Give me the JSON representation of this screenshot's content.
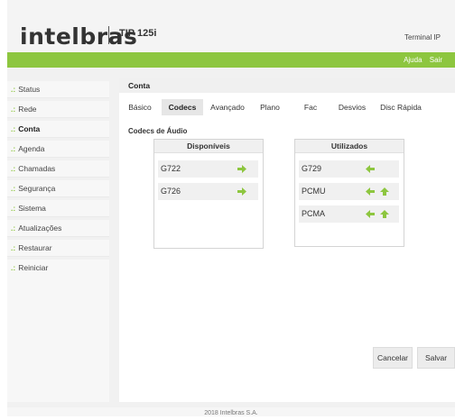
{
  "header": {
    "logo_text": "intelbras",
    "model": "TIP 125i",
    "device_label": "Terminal IP"
  },
  "topbar": {
    "help_label": "Ajuda",
    "logout_label": "Sair",
    "accent_color": "#8dc63f"
  },
  "sidebar": {
    "items": [
      {
        "label": "Status"
      },
      {
        "label": "Rede"
      },
      {
        "label": "Conta"
      },
      {
        "label": "Agenda"
      },
      {
        "label": "Chamadas"
      },
      {
        "label": "Segurança"
      },
      {
        "label": "Sistema"
      },
      {
        "label": "Atualizações"
      },
      {
        "label": "Restaurar"
      },
      {
        "label": "Reiniciar"
      }
    ],
    "bullet": ".:",
    "active_item": "Conta"
  },
  "main": {
    "title": "Conta",
    "tabs": [
      "Básico",
      "Codecs",
      "Avançado",
      "Plano",
      "Fac",
      "Desvios",
      "Disc Rápida"
    ],
    "active_tab": "Codecs",
    "section_title": "Codecs de Áudio",
    "available": {
      "header": "Disponíveis",
      "codecs": [
        "G722",
        "G726"
      ]
    },
    "used": {
      "header": "Utilizados",
      "codecs": [
        "G729",
        "PCMU",
        "PCMA"
      ]
    },
    "cancel_label": "Cancelar",
    "save_label": "Salvar"
  },
  "footer": {
    "copyright": "2018 Intelbras S.A."
  }
}
